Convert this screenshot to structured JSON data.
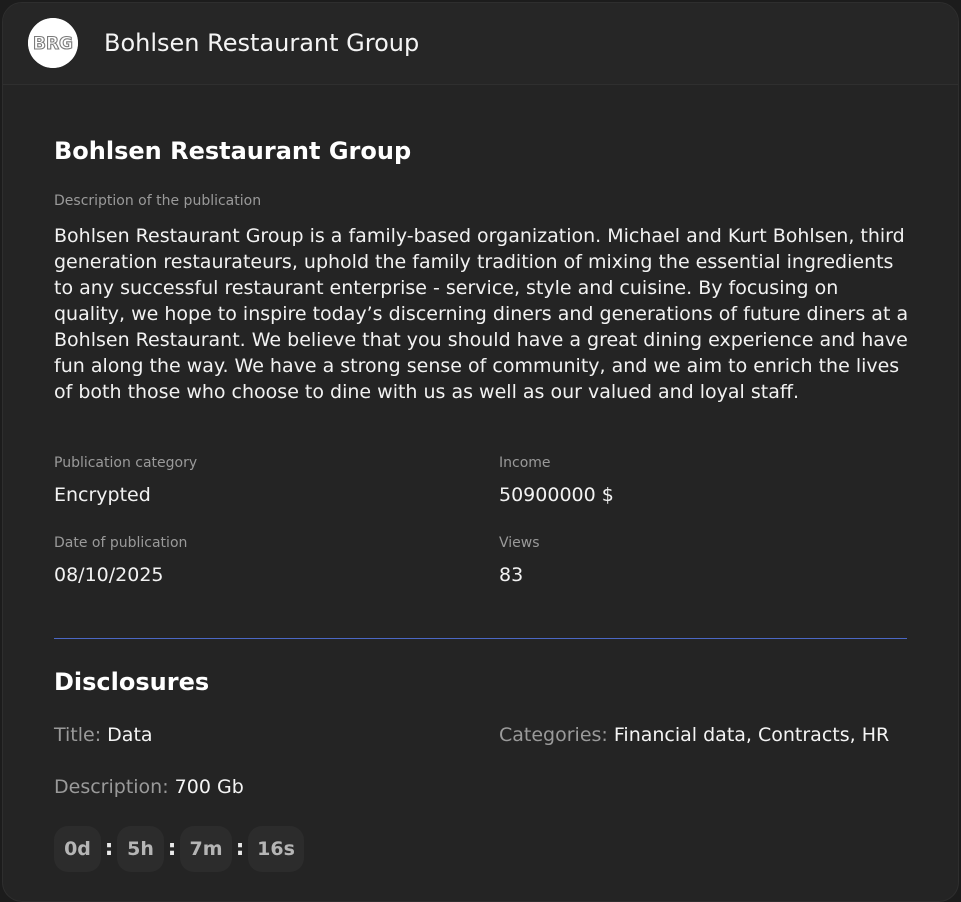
{
  "header": {
    "logo_text": "BRG",
    "title": "Bohlsen Restaurant Group"
  },
  "publication": {
    "title": "Bohlsen Restaurant Group",
    "description_label": "Description of the publication",
    "description": "Bohlsen Restaurant Group is a family-based organization. Michael and Kurt Bohlsen, third generation restaurateurs, uphold the family tradition of mixing the essential ingredients to any successful restaurant enterprise - service, style and cuisine. By focusing on quality, we hope to inspire today’s discerning diners and generations of future diners at a Bohlsen Restaurant. We believe that you should have a great dining experience and have fun along the way. We have a strong sense of community, and we aim to enrich the lives of both those who choose to dine with us as well as our valued and loyal staff.",
    "category_label": "Publication category",
    "category": "Encrypted",
    "income_label": "Income",
    "income": "50900000 $",
    "date_label": "Date of publication",
    "date": "08/10/2025",
    "views_label": "Views",
    "views": "83"
  },
  "disclosures": {
    "heading": "Disclosures",
    "title_label": "Title:",
    "title_value": "Data",
    "categories_label": "Categories:",
    "categories_value": "Financial data, Contracts, HR",
    "description_label": "Description:",
    "description_value": "700 Gb",
    "timer": {
      "days": "0d",
      "hours": "5h",
      "minutes": "7m",
      "seconds": "16s",
      "separator": ":"
    }
  },
  "colors": {
    "background": "#1c1c1c",
    "card": "#242424",
    "divider": "#4b67c4",
    "muted_text": "#9a9a9a"
  }
}
